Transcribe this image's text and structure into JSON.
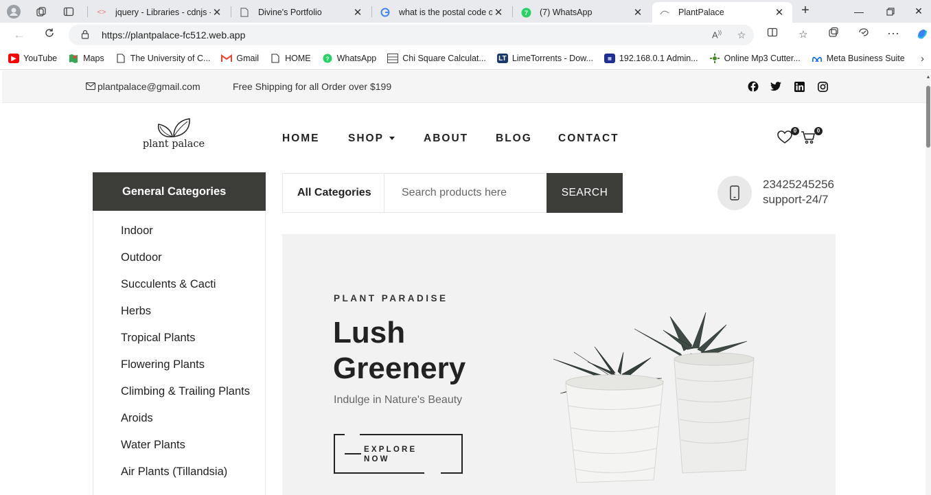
{
  "browser": {
    "tabs": [
      {
        "title": "jquery - Libraries - cdnjs - T",
        "active": false
      },
      {
        "title": "Divine's Portfolio",
        "active": false
      },
      {
        "title": "what is the postal code of",
        "active": false
      },
      {
        "title": "(7) WhatsApp",
        "active": false
      },
      {
        "title": "PlantPalace",
        "active": true
      }
    ],
    "url": "https://plantpalace-fc512.web.app",
    "bookmarks": [
      {
        "label": "YouTube",
        "icon": "youtube-icon",
        "color": "#ff0000"
      },
      {
        "label": "Maps",
        "icon": "maps-icon",
        "color": "#34a853"
      },
      {
        "label": "The University of C...",
        "icon": "page-icon",
        "color": "#ffffff"
      },
      {
        "label": "Gmail",
        "icon": "gmail-icon",
        "color": "#ea4335"
      },
      {
        "label": "HOME",
        "icon": "page-icon",
        "color": "#ffffff"
      },
      {
        "label": "WhatsApp",
        "icon": "whatsapp-icon",
        "color": "#25d366"
      },
      {
        "label": "Chi Square Calculat...",
        "icon": "calculator-icon",
        "color": "#ffffff"
      },
      {
        "label": "LimeTorrents - Dow...",
        "icon": "limetorrents-icon",
        "color": "#1a3a6b"
      },
      {
        "label": "192.168.0.1 Admin...",
        "icon": "router-icon",
        "color": "#1d2f8f"
      },
      {
        "label": "Online Mp3 Cutter...",
        "icon": "mp3-cutter-icon",
        "color": "#4a8a2a"
      },
      {
        "label": "Meta Business Suite",
        "icon": "meta-icon",
        "color": "#0866ff"
      }
    ]
  },
  "site": {
    "email": "plantpalace@gmail.com",
    "shipping": "Free Shipping for all Order over $199",
    "social": [
      "facebook-icon",
      "twitter-icon",
      "linkedin-icon",
      "instagram-icon"
    ],
    "logo_text": "plant palace",
    "nav": [
      "HOME",
      "SHOP",
      "ABOUT",
      "BLOG",
      "CONTACT"
    ],
    "wishlist_count": "0",
    "cart_count": "0",
    "categories_title": "General Categories",
    "categories": [
      "Indoor",
      "Outdoor",
      "Succulents & Cacti",
      "Herbs",
      "Tropical Plants",
      "Flowering Plants",
      "Climbing & Trailing Plants",
      "Aroids",
      "Water Plants",
      "Air Plants (Tillandsia)"
    ],
    "search": {
      "category_label": "All Categories",
      "placeholder": "Search products here",
      "button": "SEARCH"
    },
    "support": {
      "phone": "23425245256",
      "label": "support-24/7"
    },
    "hero": {
      "kicker": "PLANT PARADISE",
      "title": "Lush Greenery",
      "tagline": "Indulge in Nature's Beauty",
      "cta": "EXPLORE NOW"
    },
    "colors": {
      "dark": "#3c3d39",
      "hero_bg": "#f2f2f2"
    }
  }
}
